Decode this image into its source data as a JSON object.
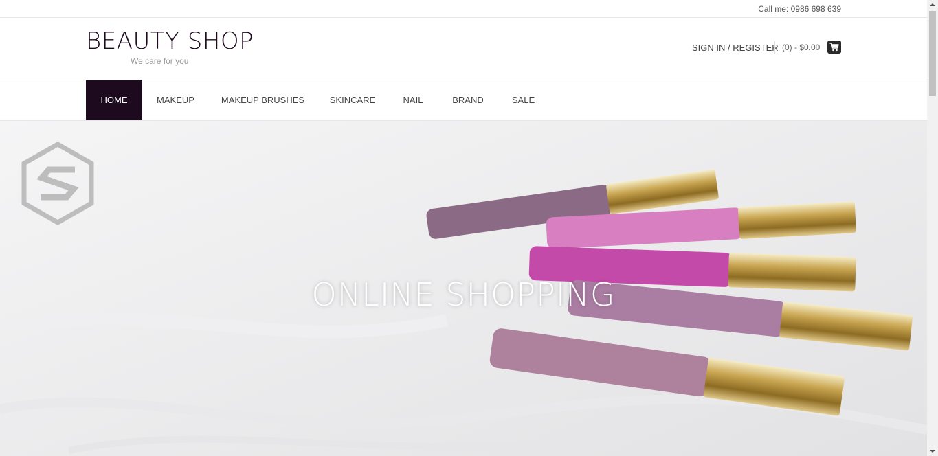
{
  "topbar": {
    "call_label": "Call me: 0986 698 639"
  },
  "header": {
    "logo_title": "BEAUTY SHOP",
    "logo_tagline": "We care for you",
    "signin_label": "SIGN IN / REGISTER",
    "cart_summary": "(0) - $0.00",
    "cart_icon": "shopping-cart-icon"
  },
  "nav": {
    "items": [
      {
        "label": "HOME",
        "active": true
      },
      {
        "label": "MAKEUP",
        "active": false
      },
      {
        "label": "MAKEUP BRUSHES",
        "active": false
      },
      {
        "label": "SKINCARE",
        "active": false
      },
      {
        "label": "NAIL",
        "active": false
      },
      {
        "label": "BRAND",
        "active": false
      },
      {
        "label": "SALE",
        "active": false
      }
    ]
  },
  "hero": {
    "title": "ONLINE SHOPPING",
    "watermark_icon": "hexagon-s-logo-icon",
    "image_subject": "lip gloss tubes lying in white sand",
    "slides_count": 2
  },
  "colors": {
    "brand_dark": "#1e0a1f",
    "accent_text": "#444444"
  }
}
